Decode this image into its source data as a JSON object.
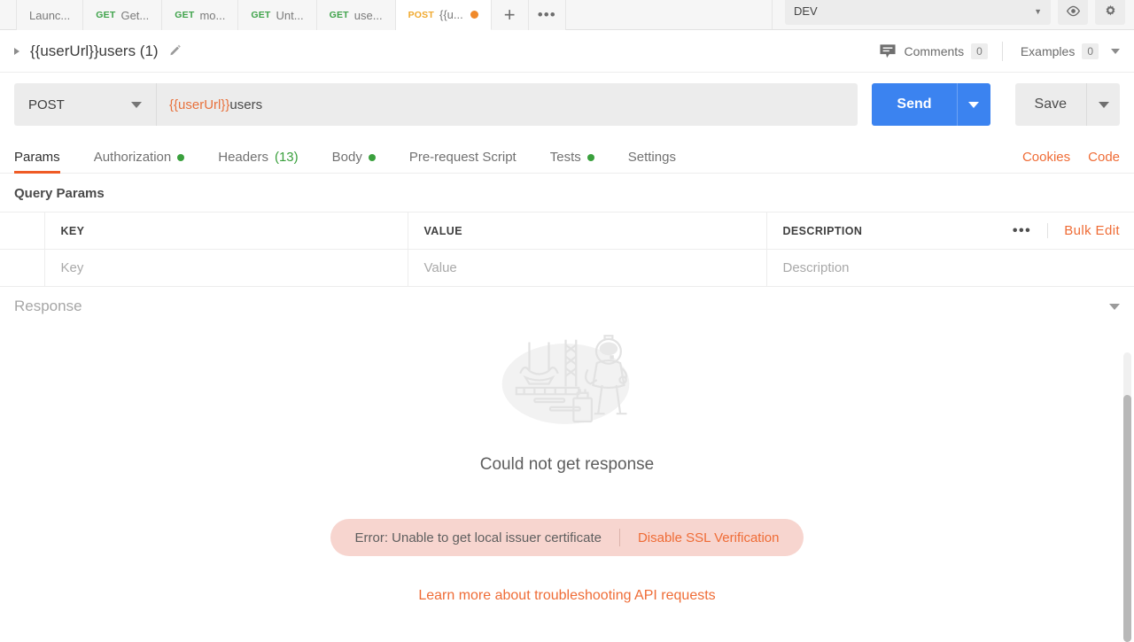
{
  "tabbar": {
    "tabs": [
      {
        "method": "",
        "name": "Launc...",
        "active": false,
        "unsaved": false
      },
      {
        "method": "GET",
        "name": "Get...",
        "active": false,
        "unsaved": false
      },
      {
        "method": "GET",
        "name": "mo...",
        "active": false,
        "unsaved": false
      },
      {
        "method": "GET",
        "name": "Unt...",
        "active": false,
        "unsaved": false
      },
      {
        "method": "GET",
        "name": "use...",
        "active": false,
        "unsaved": false
      },
      {
        "method": "POST",
        "name": "{{u...",
        "active": true,
        "unsaved": true
      }
    ],
    "new_tab_label": "+",
    "more_label": "•••",
    "environment": "DEV",
    "eye_icon": "eye-icon",
    "settings_icon": "gear-icon"
  },
  "request_header": {
    "title": "{{userUrl}}users (1)",
    "edit_icon": "pencil-icon",
    "collapse_icon": "caret-right-icon",
    "comments_label": "Comments",
    "comments_count": "0",
    "comments_icon": "comment-icon",
    "examples_label": "Examples",
    "examples_count": "0"
  },
  "url_bar": {
    "method": "POST",
    "url_variable": "{{userUrl}}",
    "url_rest": "users",
    "send_label": "Send",
    "save_label": "Save"
  },
  "request_tabs": {
    "items": [
      {
        "label": "Params",
        "active": true,
        "dot": false,
        "count": ""
      },
      {
        "label": "Authorization",
        "active": false,
        "dot": true,
        "count": ""
      },
      {
        "label": "Headers",
        "active": false,
        "dot": false,
        "count": "(13)"
      },
      {
        "label": "Body",
        "active": false,
        "dot": true,
        "count": ""
      },
      {
        "label": "Pre-request Script",
        "active": false,
        "dot": false,
        "count": ""
      },
      {
        "label": "Tests",
        "active": false,
        "dot": true,
        "count": ""
      },
      {
        "label": "Settings",
        "active": false,
        "dot": false,
        "count": ""
      }
    ],
    "cookies_label": "Cookies",
    "code_label": "Code"
  },
  "query_params": {
    "section_title": "Query Params",
    "columns": [
      "KEY",
      "VALUE",
      "DESCRIPTION"
    ],
    "more_label": "•••",
    "bulk_edit_label": "Bulk Edit",
    "rows": [
      {
        "key": "Key",
        "value": "Value",
        "description": "Description"
      }
    ]
  },
  "response": {
    "title": "Response",
    "illustration": "rocket-launchpad-astronaut-illustration",
    "empty_message": "Could not get response",
    "error_text": "Error: Unable to get local issuer certificate",
    "error_action": "Disable SSL Verification",
    "learn_more": "Learn more about troubleshooting API requests"
  },
  "colors": {
    "accent_orange": "#ef6c36",
    "send_blue": "#3b83f0",
    "green": "#3aa03d",
    "error_pill_bg": "#f7d5cf",
    "post_method": "#f0a92e",
    "get_method": "#3fa34b"
  }
}
